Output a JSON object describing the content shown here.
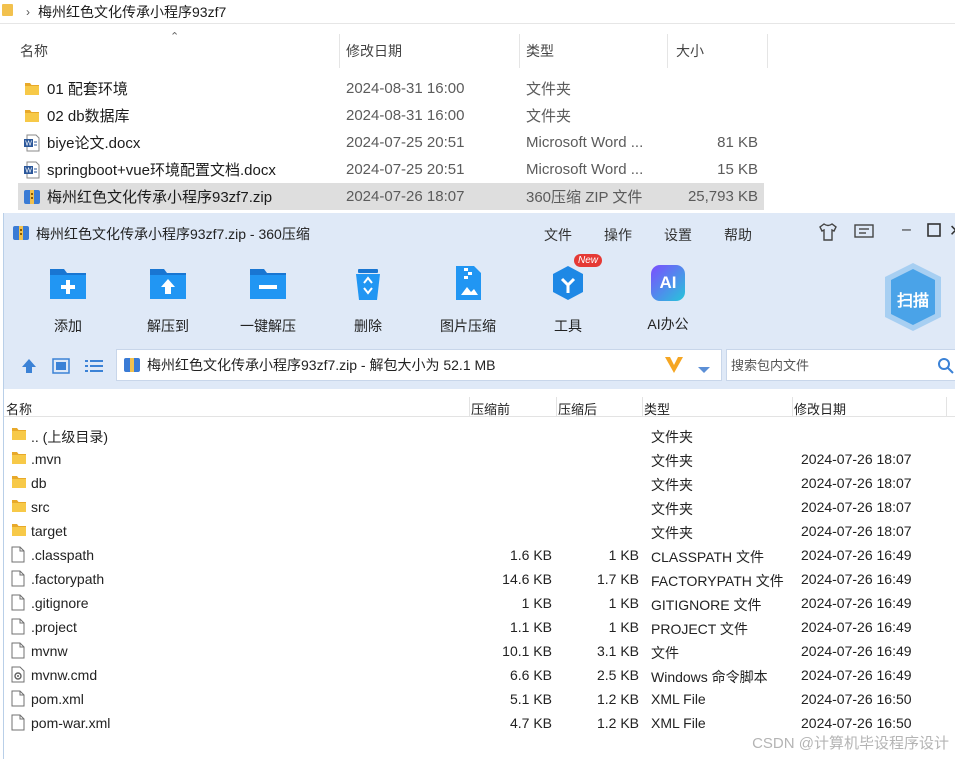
{
  "explorer": {
    "breadcrumb": "梅州红色文化传承小程序93zf7",
    "columns": {
      "name": "名称",
      "modified": "修改日期",
      "type": "类型",
      "size": "大小"
    },
    "files": [
      {
        "name": "01 配套环境",
        "modified": "2024-08-31 16:00",
        "type": "文件夹",
        "size": "",
        "icon": "folder-icon"
      },
      {
        "name": "02 db数据库",
        "modified": "2024-08-31 16:00",
        "type": "文件夹",
        "size": "",
        "icon": "folder-icon"
      },
      {
        "name": "biye论文.docx",
        "modified": "2024-07-25 20:51",
        "type": "Microsoft Word ...",
        "size": "81 KB",
        "icon": "word-doc-icon"
      },
      {
        "name": "springboot+vue环境配置文档.docx",
        "modified": "2024-07-25 20:51",
        "type": "Microsoft Word ...",
        "size": "15 KB",
        "icon": "word-doc-icon"
      },
      {
        "name": "梅州红色文化传承小程序93zf7.zip",
        "modified": "2024-07-26 18:07",
        "type": "360压缩 ZIP 文件",
        "size": "25,793 KB",
        "icon": "zip-archive-icon"
      }
    ]
  },
  "zip_window": {
    "title": "梅州红色文化传承小程序93zf7.zip - 360压缩",
    "menu": {
      "file": "文件",
      "ops": "操作",
      "settings": "设置",
      "help": "帮助"
    },
    "toolbar": {
      "add": "添加",
      "extract_to": "解压到",
      "one_click_extract": "一键解压",
      "delete": "删除",
      "image_compress": "图片压缩",
      "tools": "工具",
      "ai_office": "AI办公",
      "new_badge": "New",
      "ai_label": "AI",
      "scan": "扫描"
    },
    "path_text": "梅州红色文化传承小程序93zf7.zip - 解包大小为 52.1 MB",
    "search_placeholder": "搜索包内文件",
    "columns": {
      "name": "名称",
      "before": "压缩前",
      "after": "压缩后",
      "type": "类型",
      "modified": "修改日期"
    },
    "rows": [
      {
        "name": ".. (上级目录)",
        "before": "",
        "after": "",
        "type": "文件夹",
        "modified": "",
        "icon": "folder-icon"
      },
      {
        "name": ".mvn",
        "before": "",
        "after": "",
        "type": "文件夹",
        "modified": "2024-07-26 18:07",
        "icon": "folder-icon"
      },
      {
        "name": "db",
        "before": "",
        "after": "",
        "type": "文件夹",
        "modified": "2024-07-26 18:07",
        "icon": "folder-icon"
      },
      {
        "name": "src",
        "before": "",
        "after": "",
        "type": "文件夹",
        "modified": "2024-07-26 18:07",
        "icon": "folder-icon"
      },
      {
        "name": "target",
        "before": "",
        "after": "",
        "type": "文件夹",
        "modified": "2024-07-26 18:07",
        "icon": "folder-icon"
      },
      {
        "name": ".classpath",
        "before": "1.6 KB",
        "after": "1 KB",
        "type": "CLASSPATH 文件",
        "modified": "2024-07-26 16:49",
        "icon": "file-icon"
      },
      {
        "name": ".factorypath",
        "before": "14.6 KB",
        "after": "1.7 KB",
        "type": "FACTORYPATH 文件",
        "modified": "2024-07-26 16:49",
        "icon": "file-icon"
      },
      {
        "name": ".gitignore",
        "before": "1 KB",
        "after": "1 KB",
        "type": "GITIGNORE 文件",
        "modified": "2024-07-26 16:49",
        "icon": "file-icon"
      },
      {
        "name": ".project",
        "before": "1.1 KB",
        "after": "1 KB",
        "type": "PROJECT 文件",
        "modified": "2024-07-26 16:49",
        "icon": "file-icon"
      },
      {
        "name": "mvnw",
        "before": "10.1 KB",
        "after": "3.1 KB",
        "type": "文件",
        "modified": "2024-07-26 16:49",
        "icon": "file-icon"
      },
      {
        "name": "mvnw.cmd",
        "before": "6.6 KB",
        "after": "2.5 KB",
        "type": "Windows 命令脚本",
        "modified": "2024-07-26 16:49",
        "icon": "cmd-script-icon"
      },
      {
        "name": "pom.xml",
        "before": "5.1 KB",
        "after": "1.2 KB",
        "type": "XML File",
        "modified": "2024-07-26 16:50",
        "icon": "file-icon"
      },
      {
        "name": "pom-war.xml",
        "before": "4.7 KB",
        "after": "1.2 KB",
        "type": "XML File",
        "modified": "2024-07-26 16:50",
        "icon": "file-icon"
      }
    ]
  },
  "watermark": "CSDN @计算机毕设程序设计",
  "colors": {
    "toolbar_bg": "#dfe9f7",
    "accent_blue": "#1e88e5",
    "selected_row": "#dedede",
    "new_badge": "#e53935"
  }
}
